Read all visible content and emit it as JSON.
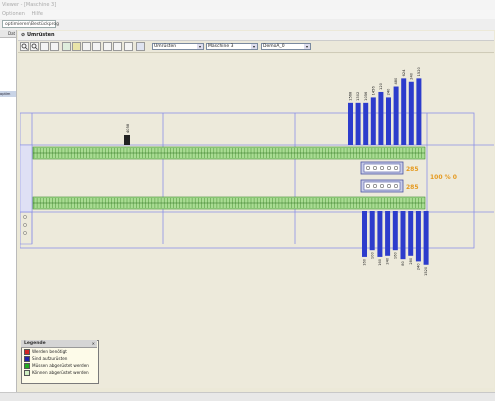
{
  "window": {
    "title": "Viewer  -  [Maschine 3]"
  },
  "menu": {
    "items": [
      "Optionen",
      "Hilfe"
    ]
  },
  "path_combo": {
    "value": "optimieren\\Bestückprog"
  },
  "sidebar": {
    "header": "Dat",
    "selected_item": "optim"
  },
  "panel": {
    "title": "Umrüsten"
  },
  "toolbar": {
    "mode_select": "Umrüsten",
    "machine_select": "Maschine  3",
    "program_select": "DemoA_0"
  },
  "board": {
    "top_feeder_label": "4058",
    "top_bars": [
      {
        "label": "1568",
        "value": 0.62
      },
      {
        "label": "1302",
        "value": 0.62
      },
      {
        "label": "1056",
        "value": 0.62
      },
      {
        "label": "1456",
        "value": 0.7
      },
      {
        "label": "120",
        "value": 0.78
      },
      {
        "label": "240",
        "value": 0.7
      },
      {
        "label": "480",
        "value": 0.86
      },
      {
        "label": "624",
        "value": 0.98
      },
      {
        "label": "240",
        "value": 0.93
      },
      {
        "label": "1520",
        "value": 0.98
      }
    ],
    "bottom_bars": [
      {
        "label": "160",
        "value": 0.82
      },
      {
        "label": "100",
        "value": 0.7
      },
      {
        "label": "160",
        "value": 0.82
      },
      {
        "label": "240",
        "value": 0.8
      },
      {
        "label": "160",
        "value": 0.7
      },
      {
        "label": "80",
        "value": 0.86
      },
      {
        "label": "280",
        "value": 0.8
      },
      {
        "label": "240",
        "value": 0.9
      },
      {
        "label": "1520",
        "value": 0.96
      }
    ],
    "component_counts": [
      "285",
      "285"
    ],
    "percent_text": "100 % 0",
    "colors": {
      "bar": "#2d3ccc",
      "grid": "#8a8fe6",
      "strip_fill": "#a9dc93",
      "strip_line": "#3f8a2c",
      "count": "#e59a20",
      "feeder": "#222222"
    }
  },
  "legend": {
    "title": "Legende",
    "items": [
      {
        "label": "Werden benötigt",
        "color": "#d22626"
      },
      {
        "label": "Sind aufzurüsten",
        "color": "#2222aa"
      },
      {
        "label": "Müssen abgerüstet werden",
        "color": "#22aa22"
      },
      {
        "label": "Können abgerüstet werden",
        "color": "#cfeec2"
      }
    ]
  }
}
